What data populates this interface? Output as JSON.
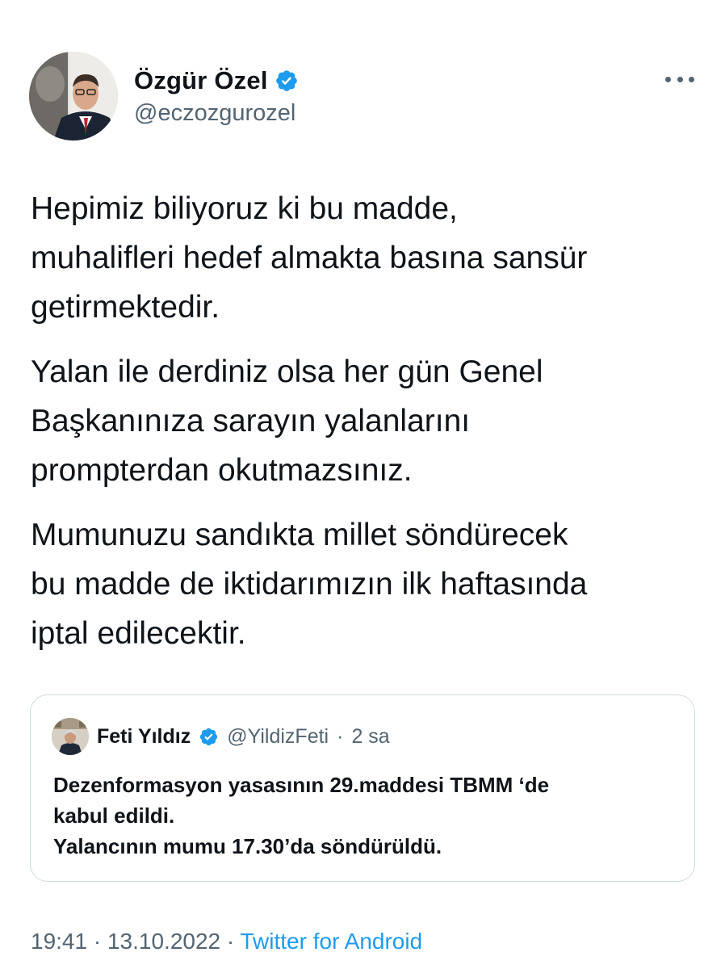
{
  "author": {
    "name": "Özgür Özel",
    "handle": "@eczozgurozel",
    "verified": true,
    "avatar_icon": "profile-photo"
  },
  "more_icon": "ellipsis-icon",
  "tweet": {
    "paragraphs": [
      "Hepimiz biliyoruz ki bu madde,\nmuhalifleri hedef almakta basına sansür\ngetirmektedir.",
      "Yalan ile derdiniz olsa her gün Genel\nBaşkanınıza sarayın yalanlarını\nprompterdan okutmazsınız.",
      "Mumunuzu sandıkta millet söndürecek\nbu madde de iktidarımızın ilk haftasında\niptal edilecektir."
    ]
  },
  "quoted": {
    "name": "Feti Yıldız",
    "handle": "@YildizFeti",
    "separator": "·",
    "time": "2 sa",
    "verified": true,
    "lines": [
      "Dezenformasyon yasasının 29.maddesi TBMM ‘de",
      "kabul edildi.",
      "Yalancının mumu 17.30’da söndürüldü."
    ]
  },
  "meta": {
    "time": "19:41",
    "separator": "·",
    "date": "13.10.2022",
    "source": "Twitter for Android"
  },
  "colors": {
    "verified_blue": "#1d9bf0",
    "secondary_text": "#536471",
    "border": "#cfd9de"
  }
}
